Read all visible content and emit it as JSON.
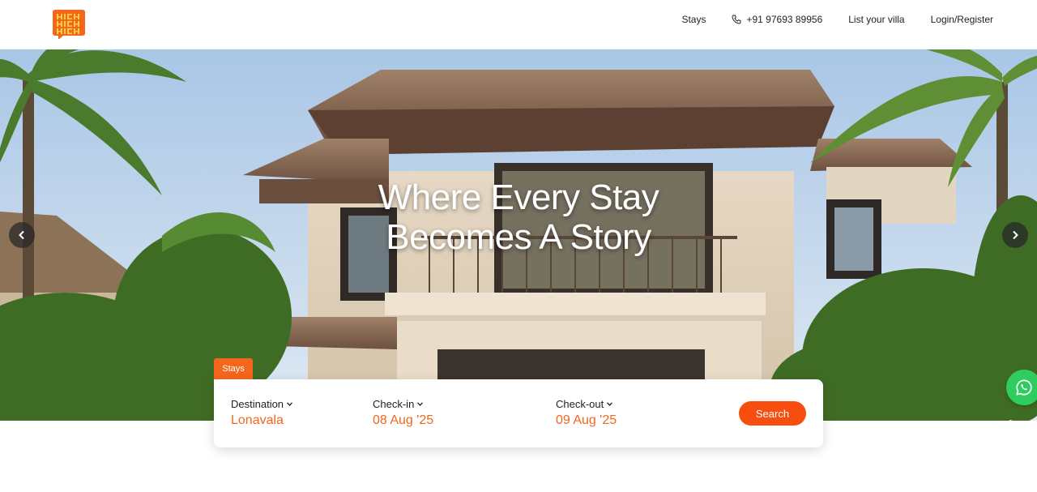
{
  "brand": {
    "logo_text": "HICH HICH HICH",
    "accent_color": "#f4661b",
    "search_color": "#f74e0f",
    "whatsapp_color": "#2fcc5f"
  },
  "nav": {
    "stays": "Stays",
    "phone_icon": "phone-icon",
    "phone": "+91 97693 89956",
    "list_villa": "List your villa",
    "login": "Login/Register"
  },
  "hero": {
    "title_line1": "Where Every Stay",
    "title_line2": "Becomes A Story",
    "prev_icon": "chevron-left-icon",
    "next_icon": "chevron-right-icon"
  },
  "search": {
    "tab_label": "Stays",
    "destination_label": "Destination",
    "destination_value": "Lonavala",
    "checkin_label": "Check-in",
    "checkin_value": "08 Aug '25",
    "checkout_label": "Check-out",
    "checkout_value": "09 Aug '25",
    "button_label": "Search"
  },
  "whatsapp": {
    "icon": "whatsapp-icon"
  }
}
